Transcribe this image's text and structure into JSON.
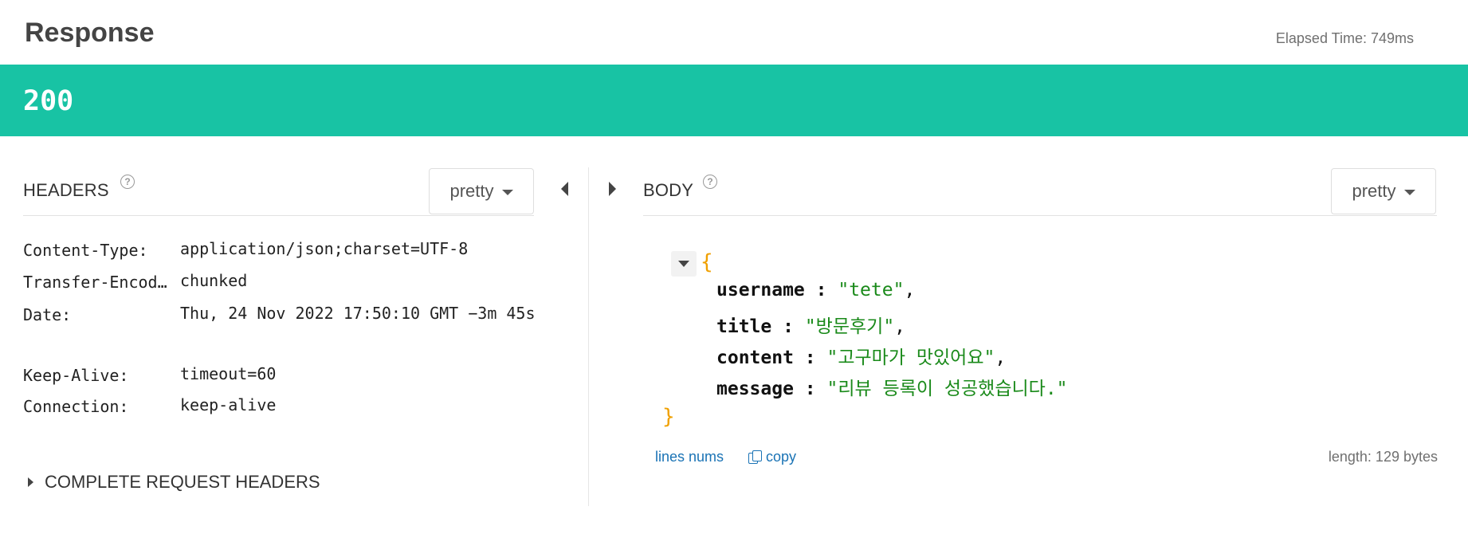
{
  "response": {
    "title": "Response",
    "elapsed": "Elapsed Time: 749ms",
    "status_code": "200"
  },
  "headers_panel": {
    "title": "HEADERS",
    "help": "?",
    "format": "pretty",
    "rows": [
      {
        "key": "Content-Type:",
        "value": "application/json;charset=UTF-8"
      },
      {
        "key": "Transfer-Encod…",
        "value": "chunked"
      },
      {
        "key": "Date:",
        "value": "Thu, 24 Nov 2022 17:50:10 GMT −3m 45s"
      },
      {
        "key": "Keep-Alive:",
        "value": "timeout=60"
      },
      {
        "key": "Connection:",
        "value": "keep-alive"
      }
    ],
    "complete_request_headers": "COMPLETE REQUEST HEADERS"
  },
  "body_panel": {
    "title": "BODY",
    "help": "?",
    "format": "pretty",
    "open_brace": "{",
    "close_brace": "}",
    "fields": [
      {
        "key": "username",
        "value": "\"tete\"",
        "comma": ","
      },
      {
        "key": "title",
        "value": "\"방문후기\"",
        "comma": ","
      },
      {
        "key": "content",
        "value": "\"고구마가 맛있어요\"",
        "comma": ","
      },
      {
        "key": "message",
        "value": "\"리뷰 등록이 성공했습니다.\"",
        "comma": ""
      }
    ],
    "colon": ":",
    "lines_nums": "lines nums",
    "copy": "copy",
    "length": "length: 129 bytes"
  },
  "colors": {
    "status_bar": "#18c3a4",
    "json_string": "#1a8a1a",
    "json_brace": "#f0a000",
    "link": "#1a73b5"
  },
  "icons": [
    "help-circle-icon",
    "caret-down-icon",
    "collapse-left-icon",
    "expand-right-icon",
    "expand-triangle-icon",
    "copy-icon"
  ]
}
